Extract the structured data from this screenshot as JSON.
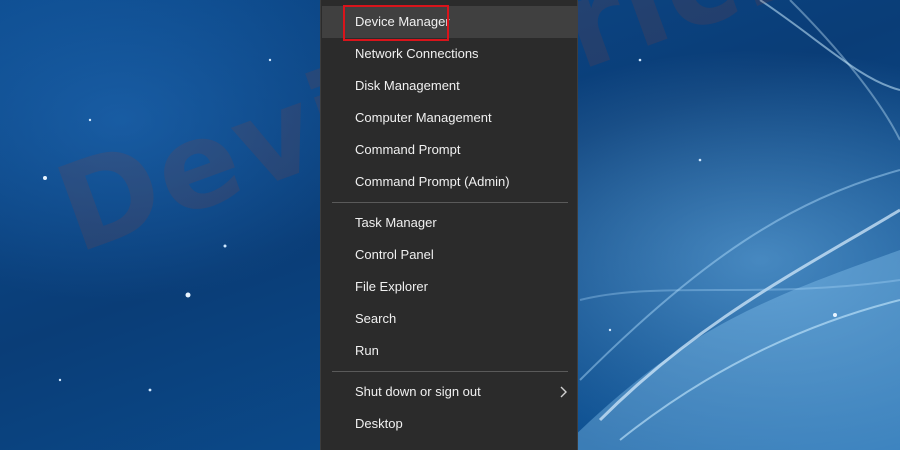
{
  "context_menu": {
    "items": [
      {
        "label": "Device Manager",
        "highlighted": true
      },
      {
        "label": "Network Connections"
      },
      {
        "label": "Disk Management"
      },
      {
        "label": "Computer Management"
      },
      {
        "label": "Command Prompt"
      },
      {
        "label": "Command Prompt (Admin)"
      },
      {
        "label": "Task Manager"
      },
      {
        "label": "Control Panel"
      },
      {
        "label": "File Explorer"
      },
      {
        "label": "Search"
      },
      {
        "label": "Run"
      },
      {
        "label": "Shut down or sign out",
        "has_submenu": true
      },
      {
        "label": "Desktop"
      }
    ]
  },
  "watermark": {
    "text": "DeviceTricks"
  },
  "colors": {
    "menu_bg": "#2b2b2b",
    "menu_text": "#f0f0f0",
    "hover_bg": "#404040",
    "highlight_border": "#d9141b"
  },
  "icons": {
    "submenu": "chevron-right-icon"
  }
}
